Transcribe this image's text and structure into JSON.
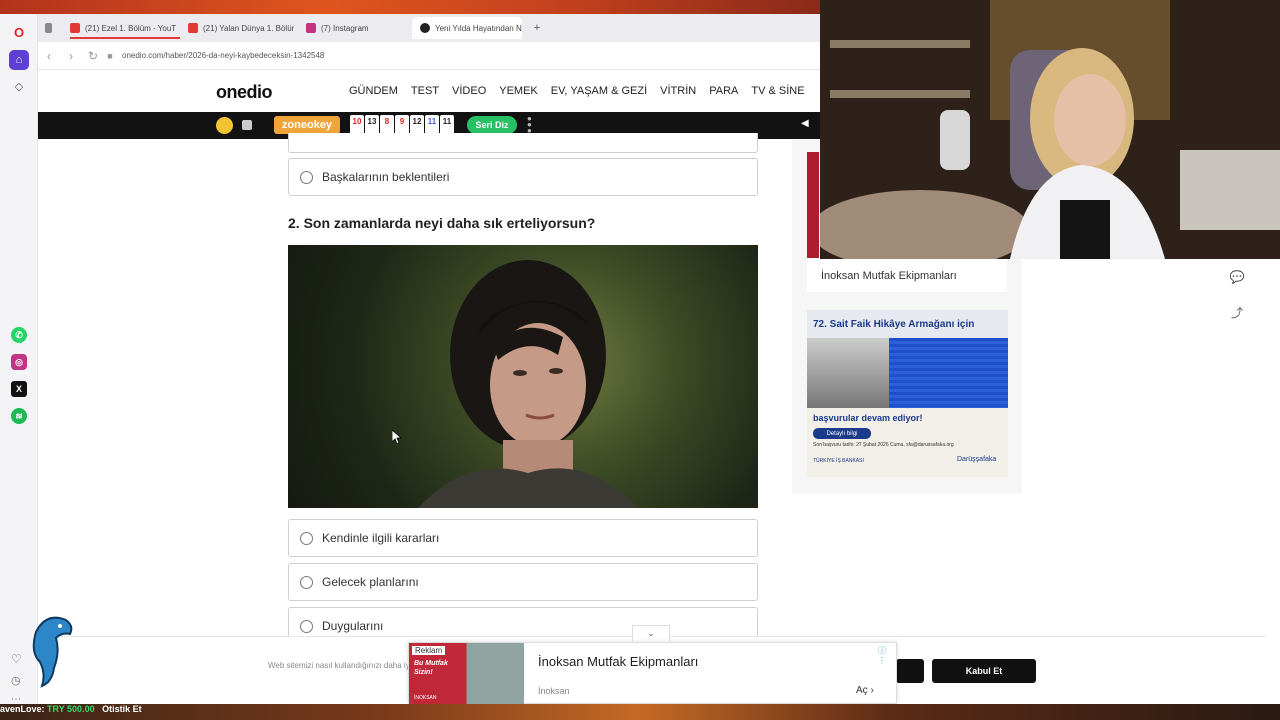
{
  "browser": {
    "tabs": [
      {
        "label": "(21) Ezel 1. Bölüm - YouTu",
        "color": "#e53935",
        "active": false
      },
      {
        "label": "(21) Yalan Dünya 1. Bölüm",
        "color": "#e53935",
        "active": false
      },
      {
        "label": "(7) Instagram",
        "color": "#c13584",
        "active": false
      },
      {
        "label": "Yeni Yılda Hayatından Ne",
        "color": "#222222",
        "active": true
      }
    ],
    "url": "onedio.com/haber/2026-da-neyi-kaybedeceksin-1342548",
    "accent": "#5d3fd3"
  },
  "site": {
    "logo": "onedio",
    "menu": [
      "GÜNDEM",
      "TEST",
      "VİDEO",
      "YEMEK",
      "EV, YAŞAM & GEZİ",
      "VİTRİN",
      "PARA",
      "TV & SİNE"
    ]
  },
  "game_bar": {
    "zone_label": "zoneokey",
    "tiles": [
      {
        "n": "10",
        "color": "#e02020"
      },
      {
        "n": "13",
        "color": "#222222"
      },
      {
        "n": "8",
        "color": "#e02020"
      },
      {
        "n": "9",
        "color": "#e02020"
      },
      {
        "n": "12",
        "color": "#222222"
      },
      {
        "n": "11",
        "color": "#3b5fd6"
      },
      {
        "n": "11",
        "color": "#222222"
      }
    ],
    "seri_label": "Seri Diz"
  },
  "quiz": {
    "prev_option": "Başkalarının beklentileri",
    "question": "2. Son zamanlarda neyi daha sık erteliyorsun?",
    "options": [
      "Kendinle ilgili kararları",
      "Gelecek planlarını",
      "Duygularını"
    ]
  },
  "sidebar_ads": {
    "card_title": "İnoksan Mutfak Ekipmanları",
    "sait_title": "72. Sait Faik Hikâye Armağanı için",
    "sait_sub": "başvurular devam ediyor!",
    "sait_button": "Detaylı bilgi",
    "sait_small": "Son başvuru tarihi: 27 Şubat 2026 Cuma, sfa@darussafaka.org",
    "sait_logo_left": "TÜRKİYE İŞ BANKASI",
    "sait_logo_right": "Darüşşafaka"
  },
  "cookie": {
    "text": "Web sitemizi nasıl kullandığınızı daha iyi anlamak için çerezler kullanıyoruz. Detaylı bilgi için",
    "accept": "Kabul Et"
  },
  "floating_ad": {
    "badge": "Reklam",
    "image_text": "Bu Mutfak Sizin!",
    "image_brand": "İNOKSAN",
    "title": "İnoksan Mutfak Ekipmanları",
    "brand": "İnoksan",
    "open": "Aç"
  },
  "stream": {
    "name": "avenLove:",
    "amount": "TRY 500.00",
    "extra": "Otistik Et"
  }
}
